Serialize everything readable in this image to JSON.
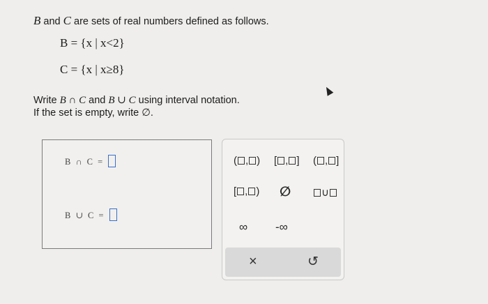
{
  "problem": {
    "intro_b": "B",
    "intro_rest": " and ",
    "intro_c": "C",
    "intro_tail": " are sets of real numbers defined as follows.",
    "def_b": "B = {x | x<2}",
    "def_c": "C = {x | x≥8}",
    "instruction_pre": "Write ",
    "instruction_expr1": "B ∩ C",
    "instruction_mid": " and ",
    "instruction_expr2": "B ∪ C",
    "instruction_post": " using interval notation.",
    "empty_note": "If the set is empty, write ∅."
  },
  "answers": {
    "intersection_label": "B ∩ C =",
    "union_label": "B ∪ C ="
  },
  "palette": {
    "open_open": [
      "(",
      ",",
      ")"
    ],
    "closed_closed": [
      "[",
      ",",
      "]"
    ],
    "open_closed": [
      "(",
      ",",
      "]"
    ],
    "closed_open": [
      "[",
      ",",
      ")"
    ],
    "empty_set": "∅",
    "union_sep": "∪",
    "infinity": "∞",
    "neg_infinity": "-∞",
    "clear": "×",
    "undo": "↺"
  }
}
